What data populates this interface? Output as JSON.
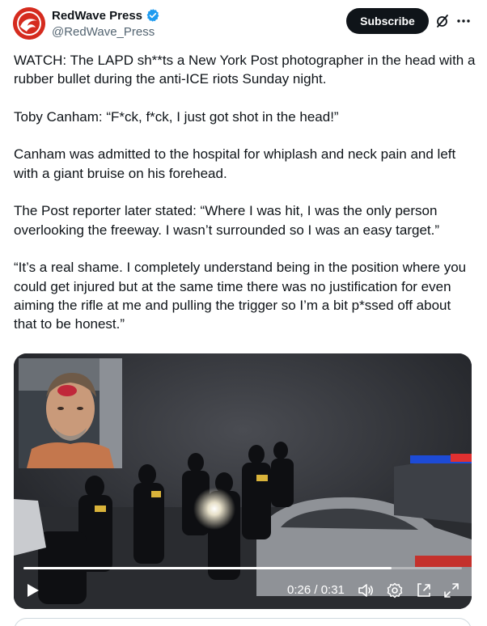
{
  "author": {
    "display_name": "RedWave Press",
    "handle": "@RedWave_Press",
    "verified_color": "#1d9bf0",
    "avatar_icon": "redwave-logo-icon",
    "avatar_color": "#d52b1e"
  },
  "actions": {
    "subscribe_label": "Subscribe",
    "grok_icon": "grok-icon",
    "more_icon": "more-icon"
  },
  "tweet": {
    "paragraphs": [
      "WATCH: The LAPD sh**ts a New York Post photographer in the head with a rubber bullet during the anti-ICE riots Sunday night.",
      "Toby Canham: “F*ck, f*ck, I just got shot in the head!”",
      "Canham was admitted to the hospital for whiplash and neck pain and left with a giant bruise on his forehead.",
      "The Post reporter later stated: “Where I was hit, I was the only person overlooking the freeway. I wasn’t surrounded so I was an easy target.”",
      "“It’s a real shame. I completely understand being in the position where you could get injured but at the same time there was no justification for even aiming the rifle at me and pulling the trigger so I’m a bit p*ssed off about that to be honest.”"
    ]
  },
  "video": {
    "current_time": "0:26",
    "duration": "0:31",
    "time_display": "0:26 / 0:31",
    "progress_fraction": 0.84,
    "controls": [
      "play-icon",
      "volume-icon",
      "settings-icon",
      "pip-icon",
      "fullscreen-icon"
    ]
  }
}
